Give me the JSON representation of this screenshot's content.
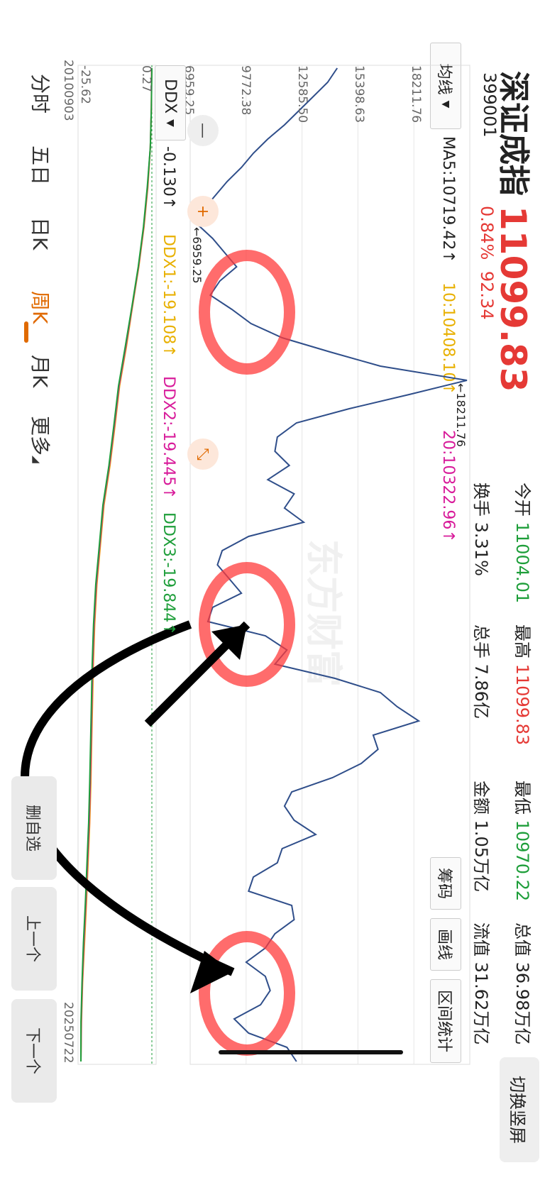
{
  "header": {
    "name": "深证成指",
    "code": "399001",
    "price": "11099.83",
    "change_pct": "0.84%",
    "change_abs": "92.34",
    "switch_label": "切换竖屏"
  },
  "stats": [
    {
      "label": "今开",
      "value": "11004.01",
      "color": "#1e9e3a"
    },
    {
      "label": "换手",
      "value": "3.31%",
      "color": "#222222"
    },
    {
      "label": "最高",
      "value": "11099.83",
      "color": "#e53935"
    },
    {
      "label": "总手",
      "value": "7.86亿",
      "color": "#222222"
    },
    {
      "label": "最低",
      "value": "10970.22",
      "color": "#1e9e3a"
    },
    {
      "label": "金额",
      "value": "1.05万亿",
      "color": "#222222"
    },
    {
      "label": "总值",
      "value": "36.98万亿",
      "color": "#222222"
    },
    {
      "label": "流值",
      "value": "31.62万亿",
      "color": "#222222"
    }
  ],
  "toolbar": {
    "ma_select": "均线",
    "ma5": "MA5:10719.42↑",
    "ma10": "10:10408.10↑",
    "ma20": "20:10322.96↑",
    "chips": "筹码",
    "draw": "画线",
    "range_stats": "区间统计"
  },
  "chart": {
    "price_ticks": [
      "18211.76",
      "15398.63",
      "12585.50",
      "9772.38",
      "6959.25"
    ],
    "max_marker": "←18211.76",
    "min_marker": "←6959.25",
    "ddx_select": "DDX",
    "ddx_value": "-0.130↑",
    "ddx1": "DDX1:-19.108↑",
    "ddx2": "DDX2:-19.445↑",
    "ddx3": "DDX3:-19.844↑",
    "ddx_ticks": [
      "0.27",
      "-25.62"
    ],
    "start_date": "20100903",
    "end_date": "20250722",
    "watermark": "东方财富"
  },
  "chart_data": {
    "type": "line",
    "title": "深证成指",
    "x_range": [
      "20100903",
      "20250722"
    ],
    "ylim": [
      6959.25,
      18211.76
    ],
    "series": [
      {
        "name": "深证成指 周K",
        "values": [
          12800,
          12400,
          11800,
          11200,
          10600,
          9900,
          9300,
          8800,
          8200,
          7700,
          7200,
          6959.25,
          7600,
          8100,
          8600,
          7900,
          7500,
          8400,
          9200,
          10500,
          12500,
          14600,
          18211.76,
          15800,
          13300,
          11100,
          10300,
          10200,
          10800,
          9900,
          11000,
          10600,
          11400,
          9100,
          8000,
          7800,
          8300,
          8800,
          7600,
          7400,
          9800,
          10700,
          10200,
          12700,
          14600,
          15300,
          16200,
          14300,
          14500,
          13800,
          12600,
          10900,
          10600,
          11000,
          11900,
          10500,
          10300,
          9300,
          9100,
          10900,
          11000,
          10200,
          9800,
          9000,
          9800,
          10000,
          9600,
          8500,
          9100,
          10700,
          11099.83
        ]
      }
    ],
    "ddx_ylim": [
      -25.62,
      0.27
    ],
    "ddx_series": [
      {
        "name": "DDX1",
        "color": "#e8b000",
        "values": [
          0.2,
          0.1,
          -0.3,
          -1.2,
          -2.6,
          -4.5,
          -6.8,
          -9.0,
          -11.5,
          -13.2,
          -15.0,
          -17.2,
          -18.5,
          -19.8,
          -20.6,
          -21.1,
          -21.4,
          -21.7,
          -22.0,
          -22.4,
          -23.0,
          -23.6,
          -24.3,
          -25.0,
          -25.4,
          -25.62
        ]
      },
      {
        "name": "DDX2",
        "color": "#d81b9a",
        "values": [
          0.2,
          0.1,
          -0.3,
          -1.3,
          -2.7,
          -4.6,
          -6.9,
          -9.2,
          -11.7,
          -13.4,
          -15.2,
          -17.4,
          -18.7,
          -20.0,
          -20.8,
          -21.3,
          -21.6,
          -21.9,
          -22.2,
          -22.6,
          -23.2,
          -23.8,
          -24.5,
          -25.1,
          -25.5,
          -25.62
        ]
      },
      {
        "name": "DDX3",
        "color": "#1e9e3a",
        "values": [
          0.27,
          0.1,
          -0.3,
          -1.4,
          -2.8,
          -4.7,
          -7.0,
          -9.4,
          -11.9,
          -13.6,
          -15.4,
          -17.6,
          -18.9,
          -20.2,
          -21.0,
          -21.5,
          -21.8,
          -22.1,
          -22.4,
          -22.8,
          -23.4,
          -24.0,
          -24.7,
          -25.2,
          -25.6,
          -25.62
        ]
      }
    ]
  },
  "tabs": [
    "分时",
    "五日",
    "日K",
    "周K",
    "月K",
    "更多"
  ],
  "active_tab": "周K",
  "side_buttons": {
    "remove": "删自选",
    "prev": "上一个",
    "next": "下一个"
  }
}
